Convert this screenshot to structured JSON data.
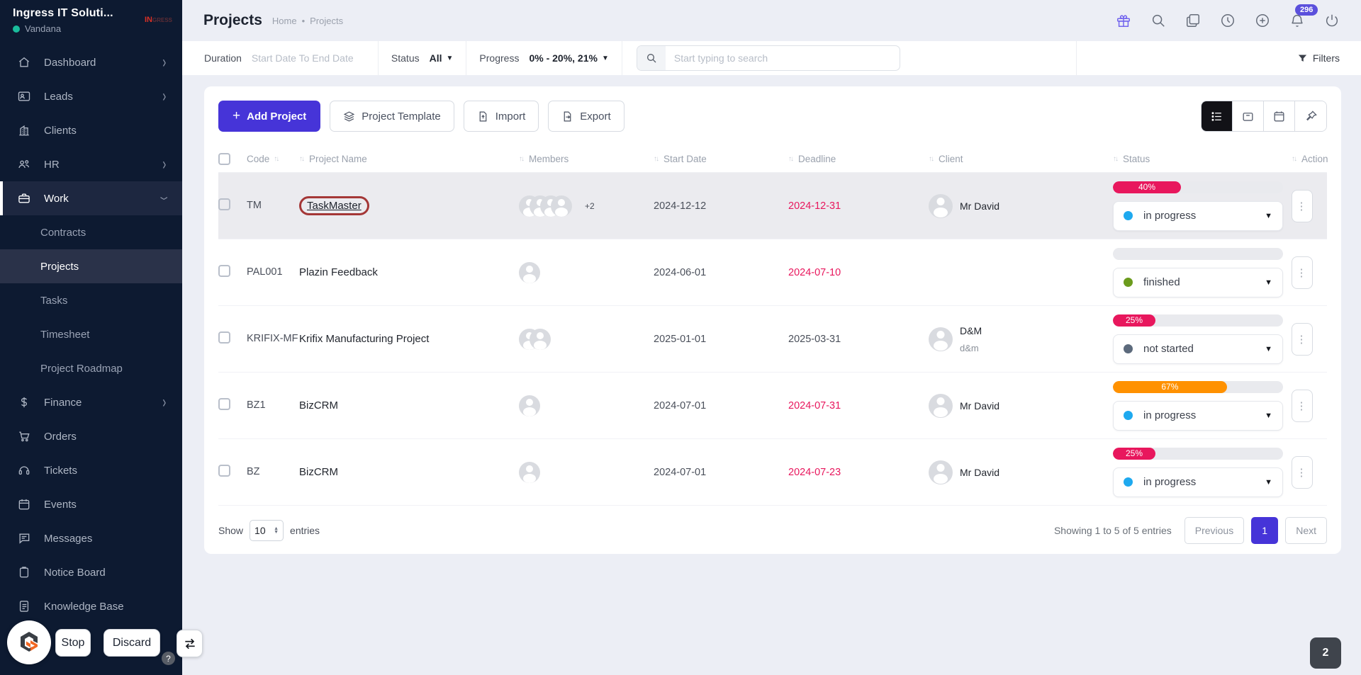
{
  "colors": {
    "primary": "#4634d8",
    "crimson": "#e8175d",
    "orange": "#ff9100",
    "blue_dot": "#1ea9ef",
    "green_dot": "#6b9b1d",
    "gray_dot": "#5c6a7c",
    "sidebar_bg": "#0d1a31",
    "badge_purple": "#5b50dc"
  },
  "sidebar": {
    "company_name": "Ingress IT Soluti...",
    "user_name": "Vandana",
    "logo_text_red": "IN",
    "logo_text_dark": "GRESS",
    "items": [
      {
        "label": "Dashboard",
        "icon": "dashboard",
        "expandable": true
      },
      {
        "label": "Leads",
        "icon": "leads",
        "expandable": true
      },
      {
        "label": "Clients",
        "icon": "clients",
        "expandable": false
      },
      {
        "label": "HR",
        "icon": "hr",
        "expandable": true
      },
      {
        "label": "Work",
        "icon": "work",
        "expandable": true,
        "expanded": true,
        "active": true
      },
      {
        "label": "Contracts",
        "sub": true
      },
      {
        "label": "Projects",
        "sub": true,
        "active": true
      },
      {
        "label": "Tasks",
        "sub": true
      },
      {
        "label": "Timesheet",
        "sub": true
      },
      {
        "label": "Project Roadmap",
        "sub": true
      },
      {
        "label": "Finance",
        "icon": "finance",
        "expandable": true
      },
      {
        "label": "Orders",
        "icon": "orders",
        "expandable": false
      },
      {
        "label": "Tickets",
        "icon": "tickets",
        "expandable": false
      },
      {
        "label": "Events",
        "icon": "events",
        "expandable": false
      },
      {
        "label": "Messages",
        "icon": "messages",
        "expandable": false
      },
      {
        "label": "Notice Board",
        "icon": "notice-board",
        "expandable": false
      },
      {
        "label": "Knowledge Base",
        "icon": "knowledge-base",
        "expandable": false
      }
    ]
  },
  "header": {
    "title": "Projects",
    "breadcrumb_home": "Home",
    "breadcrumb_separator": "•",
    "breadcrumb_current": "Projects",
    "notification_badge": "296",
    "icons": [
      "gift-icon",
      "search-icon",
      "notes-icon",
      "clock-icon",
      "plus-circle-icon",
      "bell-icon",
      "power-icon"
    ]
  },
  "filter_bar": {
    "duration_label": "Duration",
    "duration_placeholder": "Start Date To End Date",
    "status_label": "Status",
    "status_value": "All",
    "progress_label": "Progress",
    "progress_value": "0% - 20%, 21%",
    "search_placeholder": "Start typing to search",
    "filters_label": "Filters"
  },
  "toolbar": {
    "add_project_label": "Add Project",
    "project_template_label": "Project Template",
    "import_label": "Import",
    "export_label": "Export",
    "view_toggles": [
      "list-view",
      "board-view",
      "calendar-view",
      "pinned-view"
    ]
  },
  "table": {
    "headers": [
      "Code",
      "Project Name",
      "Members",
      "Start Date",
      "Deadline",
      "Client",
      "Status",
      "Action"
    ],
    "rows": [
      {
        "code": "TM",
        "name": "TaskMaster",
        "name_annotated": true,
        "members": 4,
        "members_extra": "+2",
        "start_date": "2024-12-12",
        "deadline": "2024-12-31",
        "deadline_overdue": true,
        "client_name": "Mr David",
        "client_sub": "",
        "progress_percent": 40,
        "progress_label": "40%",
        "progress_color": "#e8175d",
        "status_label": "in progress",
        "status_dot_color": "#1ea9ef",
        "highlighted": true
      },
      {
        "code": "PAL001",
        "name": "Plazin Feedback",
        "name_annotated": false,
        "members": 1,
        "members_extra": "",
        "start_date": "2024-06-01",
        "deadline": "2024-07-10",
        "deadline_overdue": true,
        "client_name": "",
        "client_sub": "",
        "progress_percent": 0,
        "progress_label": "",
        "progress_color": "",
        "status_label": "finished",
        "status_dot_color": "#6b9b1d",
        "highlighted": false
      },
      {
        "code": "KRIFIX-MF",
        "name": "Krifix Manufacturing Project",
        "name_annotated": false,
        "members": 2,
        "members_extra": "",
        "start_date": "2025-01-01",
        "deadline": "2025-03-31",
        "deadline_overdue": false,
        "client_name": "D&M",
        "client_sub": "d&m",
        "progress_percent": 25,
        "progress_label": "25%",
        "progress_color": "#e8175d",
        "status_label": "not started",
        "status_dot_color": "#5c6a7c",
        "highlighted": false
      },
      {
        "code": "BZ1",
        "name": "BizCRM",
        "name_annotated": false,
        "members": 1,
        "members_extra": "",
        "start_date": "2024-07-01",
        "deadline": "2024-07-31",
        "deadline_overdue": true,
        "client_name": "Mr David",
        "client_sub": "",
        "progress_percent": 67,
        "progress_label": "67%",
        "progress_color": "#ff9100",
        "status_label": "in progress",
        "status_dot_color": "#1ea9ef",
        "highlighted": false
      },
      {
        "code": "BZ",
        "name": "BizCRM",
        "name_annotated": false,
        "members": 1,
        "members_extra": "",
        "start_date": "2024-07-01",
        "deadline": "2024-07-23",
        "deadline_overdue": true,
        "client_name": "Mr David",
        "client_sub": "",
        "progress_percent": 25,
        "progress_label": "25%",
        "progress_color": "#e8175d",
        "status_label": "in progress",
        "status_dot_color": "#1ea9ef",
        "highlighted": false
      }
    ]
  },
  "pagination": {
    "show_label": "Show",
    "show_value": "10",
    "entries_label": "entries",
    "summary": "Showing 1 to 5 of 5 entries",
    "previous_label": "Previous",
    "page_number": "1",
    "next_label": "Next"
  },
  "agent_overlay": {
    "stop_label": "Stop",
    "discard_label": "Discard",
    "help_label": "?",
    "badge_count": "2"
  }
}
